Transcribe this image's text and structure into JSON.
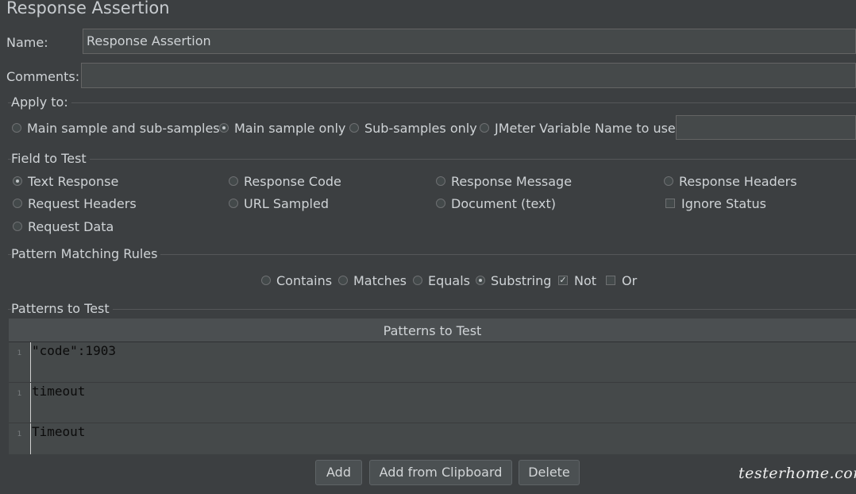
{
  "title": "Response Assertion",
  "name": {
    "label": "Name:",
    "value": "Response Assertion"
  },
  "comments": {
    "label": "Comments:",
    "value": ""
  },
  "apply_to": {
    "legend": "Apply to:",
    "options": [
      {
        "label": "Main sample and sub-samples",
        "selected": false
      },
      {
        "label": "Main sample only",
        "selected": true
      },
      {
        "label": "Sub-samples only",
        "selected": false
      },
      {
        "label": "JMeter Variable Name to use",
        "selected": false
      }
    ],
    "variable_value": ""
  },
  "field_to_test": {
    "legend": "Field to Test",
    "options": [
      {
        "label": "Text Response",
        "selected": true
      },
      {
        "label": "Response Code",
        "selected": false
      },
      {
        "label": "Response Message",
        "selected": false
      },
      {
        "label": "Response Headers",
        "selected": false
      },
      {
        "label": "Request Headers",
        "selected": false
      },
      {
        "label": "URL Sampled",
        "selected": false
      },
      {
        "label": "Document (text)",
        "selected": false
      },
      {
        "label": "Request Data",
        "selected": false
      }
    ],
    "ignore_status": {
      "label": "Ignore Status",
      "checked": false
    }
  },
  "pattern_rules": {
    "legend": "Pattern Matching Rules",
    "options": [
      {
        "label": "Contains",
        "selected": false
      },
      {
        "label": "Matches",
        "selected": false
      },
      {
        "label": "Equals",
        "selected": false
      },
      {
        "label": "Substring",
        "selected": true
      }
    ],
    "not": {
      "label": "Not",
      "checked": true
    },
    "or": {
      "label": "Or",
      "checked": false
    }
  },
  "patterns": {
    "legend": "Patterns to Test",
    "column_header": "Patterns to Test",
    "rows": [
      {
        "line": "1",
        "text": "\"code\":1903"
      },
      {
        "line": "1",
        "text": "timeout"
      },
      {
        "line": "1",
        "text": "Timeout"
      }
    ]
  },
  "buttons": {
    "add": "Add",
    "add_clipboard": "Add from Clipboard",
    "delete": "Delete"
  },
  "watermark": "testerhome.com"
}
